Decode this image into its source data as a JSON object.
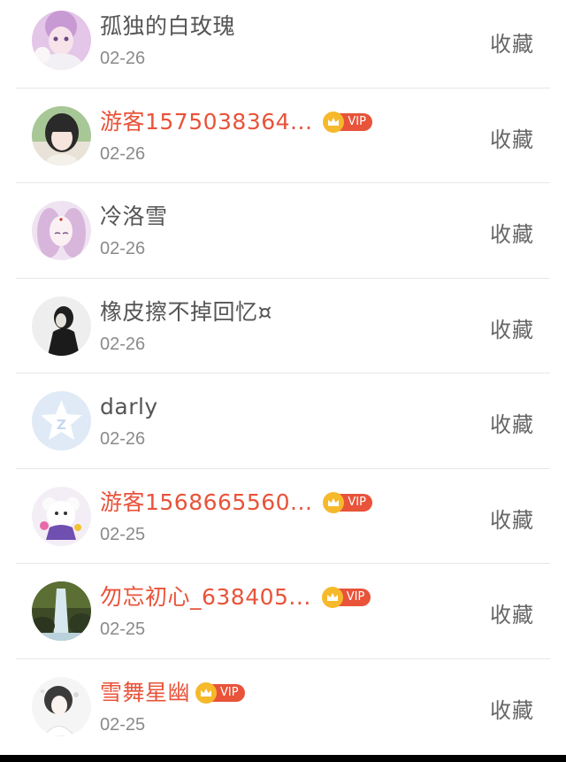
{
  "action_label": "收藏",
  "vip_label": "VIP",
  "items": [
    {
      "name": "孤独的白玫瑰",
      "date": "02-26",
      "vip": false,
      "avatar": "doll-girl-avatar",
      "colors": [
        "#d9b7e0",
        "#f3d6ea",
        "#7a5a8a"
      ]
    },
    {
      "name": "游客1575038364...",
      "date": "02-26",
      "vip": true,
      "avatar": "girl-photo-avatar",
      "colors": [
        "#9fbf8a",
        "#f1e6dd",
        "#2b2b2b"
      ]
    },
    {
      "name": "冷洛雪",
      "date": "02-26",
      "vip": false,
      "avatar": "anime-girl-avatar",
      "colors": [
        "#e9d9ee",
        "#f7eef5",
        "#b48ab8"
      ]
    },
    {
      "name": "橡皮擦不掉回忆¤",
      "date": "02-26",
      "vip": false,
      "avatar": "dark-figure-avatar",
      "colors": [
        "#e8e8e8",
        "#f4f4f4",
        "#1e1e1e"
      ]
    },
    {
      "name": "darly",
      "date": "02-26",
      "vip": false,
      "avatar": "default-qq-avatar",
      "colors": [
        "#dde9f6",
        "#ffffff",
        "#c3d6ec"
      ]
    },
    {
      "name": "游客1568665560...",
      "date": "02-25",
      "vip": true,
      "avatar": "plush-bear-avatar",
      "colors": [
        "#f3eef7",
        "#ffffff",
        "#7d59b8"
      ]
    },
    {
      "name": "勿忘初心_638405...",
      "date": "02-25",
      "vip": true,
      "avatar": "waterfall-avatar",
      "colors": [
        "#556b2f",
        "#cfe3ea",
        "#2a3520"
      ]
    },
    {
      "name": "雪舞星幽",
      "date": "02-25",
      "vip": true,
      "avatar": "snow-girl-avatar",
      "colors": [
        "#f2f2f2",
        "#ffffff",
        "#3a3a3a"
      ]
    }
  ]
}
